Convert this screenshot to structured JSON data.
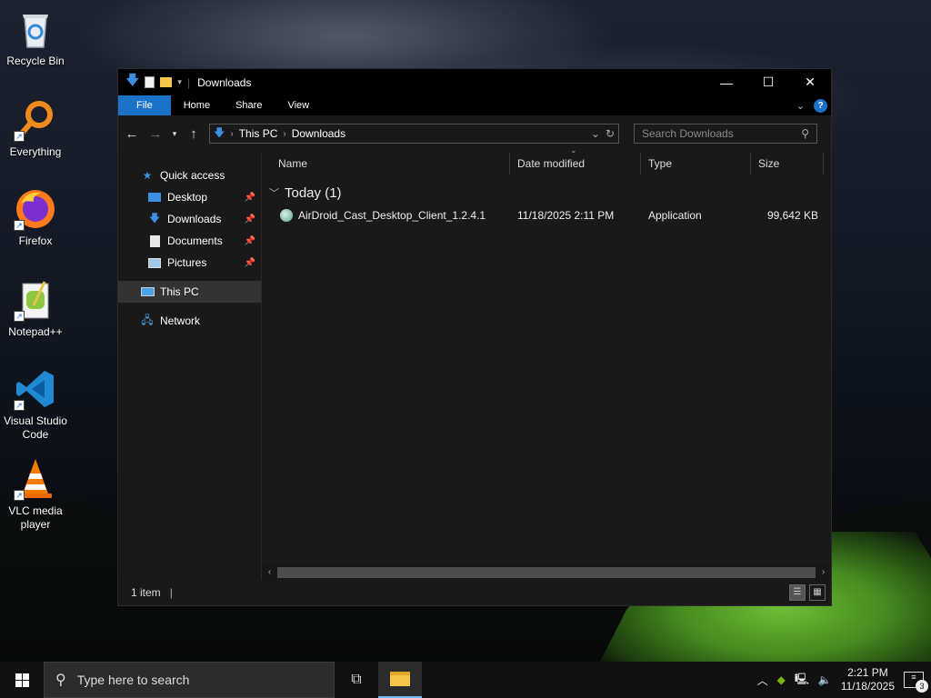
{
  "desktop": {
    "icons": [
      {
        "label": "Recycle Bin",
        "icon": "recycle-bin-icon"
      },
      {
        "label": "Everything",
        "icon": "everything-search-icon"
      },
      {
        "label": "Firefox",
        "icon": "firefox-icon"
      },
      {
        "label": "Notepad++",
        "icon": "notepad-plus-plus-icon"
      },
      {
        "label": "Visual Studio Code",
        "icon": "vscode-icon"
      },
      {
        "label": "VLC media player",
        "icon": "vlc-icon"
      }
    ]
  },
  "window": {
    "title": "Downloads",
    "ribbon": {
      "file": "File",
      "home": "Home",
      "share": "Share",
      "view": "View"
    },
    "address": {
      "crumb1": "This PC",
      "crumb2": "Downloads"
    },
    "search_placeholder": "Search Downloads",
    "nav": {
      "quick_access": "Quick access",
      "desktop": "Desktop",
      "downloads": "Downloads",
      "documents": "Documents",
      "pictures": "Pictures",
      "this_pc": "This PC",
      "network": "Network"
    },
    "columns": {
      "name": "Name",
      "date": "Date modified",
      "type": "Type",
      "size": "Size"
    },
    "group_label": "Today (1)",
    "files": [
      {
        "name": "AirDroid_Cast_Desktop_Client_1.2.4.1",
        "date": "11/18/2025 2:11 PM",
        "type": "Application",
        "size": "99,642 KB"
      }
    ],
    "status": "1 item"
  },
  "taskbar": {
    "search_placeholder": "Type here to search",
    "time": "2:21 PM",
    "date": "11/18/2025",
    "notifications": "3"
  },
  "colors": {
    "accent": "#1a73c8",
    "window_bg": "#191919",
    "titlebar": "#000000"
  }
}
